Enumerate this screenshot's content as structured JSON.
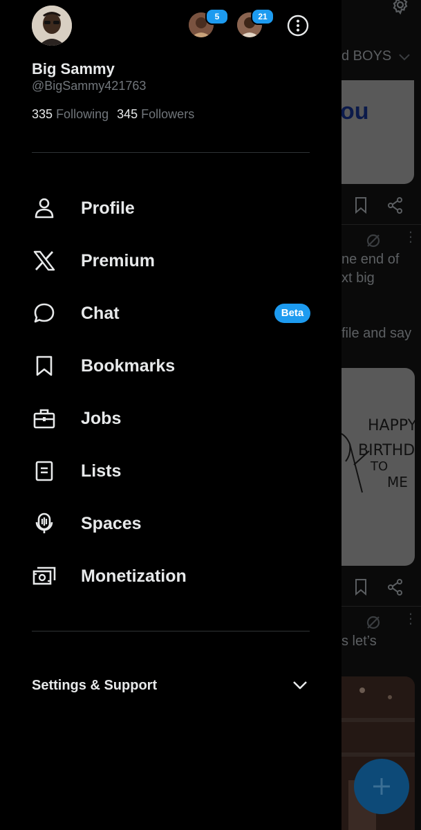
{
  "profile": {
    "name": "Big Sammy",
    "handle": "@BigSammy421763",
    "following_count": "335",
    "following_label": "Following",
    "followers_count": "345",
    "followers_label": "Followers"
  },
  "accounts": [
    {
      "badge": "5"
    },
    {
      "badge": "21"
    }
  ],
  "menu": {
    "items": [
      {
        "label": "Profile",
        "icon": "person-icon"
      },
      {
        "label": "Premium",
        "icon": "x-logo-icon"
      },
      {
        "label": "Chat",
        "icon": "chat-bubble-icon",
        "badge": "Beta"
      },
      {
        "label": "Bookmarks",
        "icon": "bookmark-icon"
      },
      {
        "label": "Jobs",
        "icon": "briefcase-icon"
      },
      {
        "label": "Lists",
        "icon": "list-icon"
      },
      {
        "label": "Spaces",
        "icon": "spaces-mic-icon"
      },
      {
        "label": "Monetization",
        "icon": "money-icon"
      }
    ]
  },
  "settings": {
    "label": "Settings & Support"
  },
  "background": {
    "tab_label": "d BOYS",
    "card1_text": "ou",
    "text_lines": [
      "ne end of",
      "xt big",
      "file and say",
      "s let’s"
    ],
    "card2_text": [
      "HAPPY",
      "BIRTHDA",
      "TO",
      "ME"
    ]
  },
  "colors": {
    "background": "#000000",
    "text_primary": "#e7e9ea",
    "text_secondary": "#71767b",
    "accent": "#1d9bf0",
    "divider": "#2f3336"
  }
}
